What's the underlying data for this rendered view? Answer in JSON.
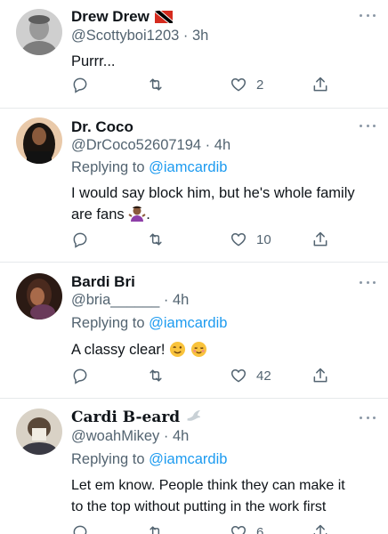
{
  "colors": {
    "accent": "#1d9bf0",
    "muted": "#536471",
    "text": "#0f1419",
    "divider": "#e6e9eb"
  },
  "tweets": [
    {
      "name": "Drew Drew",
      "handle": "@Scottyboi1203",
      "time": "3h",
      "replying_prefix": "",
      "replying_to": "",
      "text": "Purrr...",
      "likes": "2",
      "badge": "trinidad-and-tobago-flag-icon"
    },
    {
      "name": "Dr. Coco",
      "handle": "@DrCoco52607194",
      "time": "4h",
      "replying_prefix": "Replying to ",
      "replying_to": "@iamcardib",
      "text": "I would say block him, but he's whole family are fans",
      "text_suffix": ".",
      "likes": "10",
      "emoji": "person-shrugging-emoji"
    },
    {
      "name": "Bardi Bri",
      "handle": "@bria______",
      "time": "4h",
      "replying_prefix": "Replying to ",
      "replying_to": "@iamcardib",
      "text": "A classy clear!",
      "likes": "42",
      "emoji": [
        "winking-face-emoji",
        "smiling-face-emoji"
      ]
    },
    {
      "name": "Cardi B-eard",
      "handle": "@woahMikey",
      "time": "4h",
      "replying_prefix": "Replying to ",
      "replying_to": "@iamcardib",
      "text_line1": "Let em know. People think they can make it",
      "text_line2": "to the top without putting in the work first",
      "likes": "6",
      "badge": "dove-icon"
    }
  ]
}
